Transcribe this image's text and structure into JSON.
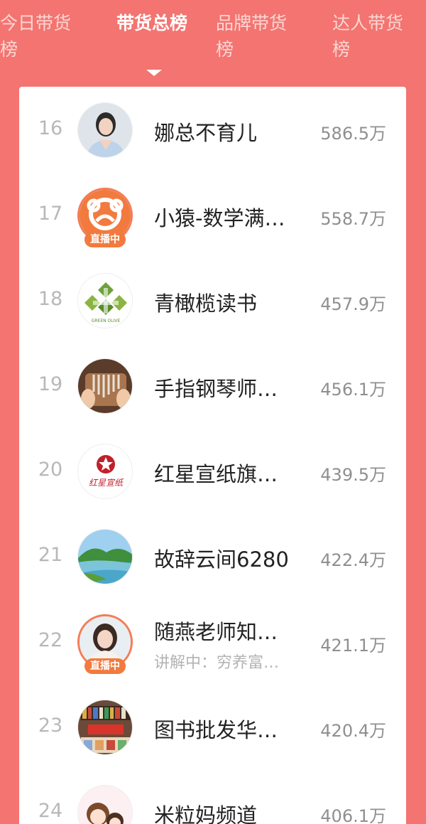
{
  "tabs": [
    {
      "label": "今日带货榜"
    },
    {
      "label": "带货总榜"
    },
    {
      "label": "品牌带货榜"
    },
    {
      "label": "达人带货榜"
    }
  ],
  "ranking": [
    {
      "rank": "16",
      "name": "娜总不育儿",
      "value": "586.5万",
      "live": false,
      "avatar_icon": "woman-portrait-avatar"
    },
    {
      "rank": "17",
      "name": "小猿-数学满…",
      "value": "558.7万",
      "live": true,
      "badge": "直播中",
      "avatar_icon": "monkey-logo-avatar"
    },
    {
      "rank": "18",
      "name": "青橄榄读书",
      "value": "457.9万",
      "live": false,
      "avatar_icon": "green-olive-logo-avatar",
      "logo_text": "GREEN OLIVE"
    },
    {
      "rank": "19",
      "name": "手指钢琴师…",
      "value": "456.1万",
      "live": false,
      "avatar_icon": "kalimba-avatar"
    },
    {
      "rank": "20",
      "name": "红星宣纸旗…",
      "value": "439.5万",
      "live": false,
      "avatar_icon": "red-star-logo-avatar",
      "logo_text": "红星宣纸"
    },
    {
      "rank": "21",
      "name": "故辞云间6280",
      "value": "422.4万",
      "live": false,
      "avatar_icon": "landscape-avatar"
    },
    {
      "rank": "22",
      "name": "随燕老师知…",
      "sub": "讲解中：穷养富…",
      "value": "421.1万",
      "live": true,
      "badge": "直播中",
      "avatar_icon": "teacher-portrait-avatar"
    },
    {
      "rank": "23",
      "name": "图书批发华…",
      "value": "420.4万",
      "live": false,
      "avatar_icon": "bookstore-avatar"
    },
    {
      "rank": "24",
      "name": "米粒妈频道",
      "value": "406.1万",
      "live": false,
      "avatar_icon": "cartoon-family-avatar"
    }
  ],
  "colors": {
    "background": "#f37470",
    "live_badge": "#f27a3e"
  }
}
